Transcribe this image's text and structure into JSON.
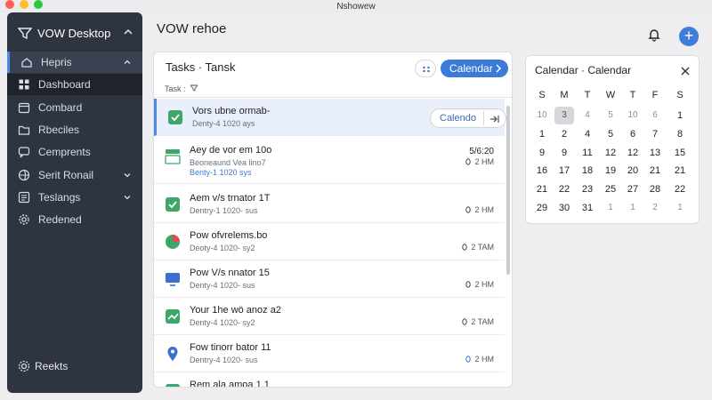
{
  "window": {
    "title": "Nshowew"
  },
  "sidebar": {
    "title": "VOW Desktop",
    "items": [
      {
        "label": "Hepris",
        "icon": "home-icon",
        "state": "section"
      },
      {
        "label": "Dashboard",
        "icon": "dashboard-icon",
        "state": "active"
      },
      {
        "label": "Combard",
        "icon": "calendar-icon",
        "state": ""
      },
      {
        "label": "Rbeciles",
        "icon": "folder-icon",
        "state": ""
      },
      {
        "label": "Cemprents",
        "icon": "chat-icon",
        "state": ""
      },
      {
        "label": "Serit Ronail",
        "icon": "globe-icon",
        "state": "",
        "chevron": true
      },
      {
        "label": "Teslangs",
        "icon": "list-icon",
        "state": "",
        "chevron": true
      },
      {
        "label": "Redened",
        "icon": "gear-icon",
        "state": ""
      }
    ],
    "footer": {
      "label": "Reekts",
      "icon": "settings-icon"
    }
  },
  "main": {
    "title": "VOW rehoe"
  },
  "tasks": {
    "title": "Tasks · Tansk",
    "calendar_button": "Calendar",
    "filter_label": "Task :",
    "rows": [
      {
        "name": "Vors ubne ormab-",
        "sub": "Denty-4 1020 ays",
        "pill_label": "Calendo",
        "selected": true,
        "icon": "check-square-icon",
        "color": "#3fa66a"
      },
      {
        "name": "Aey de vor em 10o",
        "sub": "Beoneaund Vea lino7",
        "sub2": "Benty-1 1020 sys",
        "time": "5/6:20",
        "meta": "2 HM",
        "icon": "chart-icon",
        "color": "#3fa66a"
      },
      {
        "name": "Aem v/s trnator 1T",
        "sub": "Dentry-1 1020- sus",
        "meta": "2 HM",
        "icon": "check-square-icon",
        "color": "#3fa66a"
      },
      {
        "name": "Pow ofvrelems.bo",
        "sub": "Deoty-4 1020- sy2",
        "meta": "2 TAM",
        "icon": "pie-icon",
        "color": "#3fa66a"
      },
      {
        "name": "Pow V/s nnator 15",
        "sub": "Denty-4 1020- sus",
        "meta": "2 HM",
        "icon": "monitor-icon",
        "color": "#3b6fd0"
      },
      {
        "name": "Your 1he wö anoz a2",
        "sub": "Denty-4 1020- sy2",
        "meta": "2 TAM",
        "icon": "trend-icon",
        "color": "#3fa66a"
      },
      {
        "name": "Fow tinorr bator 11",
        "sub": "Dentry-4 1020- sus",
        "meta": "2 HM",
        "icon": "location-icon",
        "color": "#3b6fd0"
      },
      {
        "name": "Rem ala amoa 1.1",
        "sub": "",
        "meta": "",
        "icon": "check-square-icon",
        "color": "#3fa66a"
      }
    ]
  },
  "calendar": {
    "title": "Calendar · Calendar",
    "dow": [
      "S",
      "M",
      "T",
      "W",
      "T",
      "F",
      "S"
    ],
    "weeks": [
      [
        {
          "d": "10",
          "m": true
        },
        {
          "d": "3",
          "m": true,
          "t": true
        },
        {
          "d": "4",
          "m": true
        },
        {
          "d": "5",
          "m": true
        },
        {
          "d": "10",
          "m": true
        },
        {
          "d": "6",
          "m": true
        },
        {
          "d": "1"
        }
      ],
      [
        {
          "d": "1"
        },
        {
          "d": "2"
        },
        {
          "d": "4"
        },
        {
          "d": "5"
        },
        {
          "d": "6"
        },
        {
          "d": "7"
        },
        {
          "d": "8"
        }
      ],
      [
        {
          "d": "9"
        },
        {
          "d": "9"
        },
        {
          "d": "11"
        },
        {
          "d": "12"
        },
        {
          "d": "12"
        },
        {
          "d": "13"
        },
        {
          "d": "15"
        }
      ],
      [
        {
          "d": "16"
        },
        {
          "d": "17"
        },
        {
          "d": "18"
        },
        {
          "d": "19"
        },
        {
          "d": "20"
        },
        {
          "d": "21"
        },
        {
          "d": "21"
        }
      ],
      [
        {
          "d": "21"
        },
        {
          "d": "22"
        },
        {
          "d": "23"
        },
        {
          "d": "25"
        },
        {
          "d": "27"
        },
        {
          "d": "28"
        },
        {
          "d": "22"
        }
      ],
      [
        {
          "d": "29"
        },
        {
          "d": "30"
        },
        {
          "d": "31"
        },
        {
          "d": "1",
          "m": true
        },
        {
          "d": "1",
          "m": true
        },
        {
          "d": "2",
          "m": true
        },
        {
          "d": "1",
          "m": true
        }
      ]
    ]
  }
}
